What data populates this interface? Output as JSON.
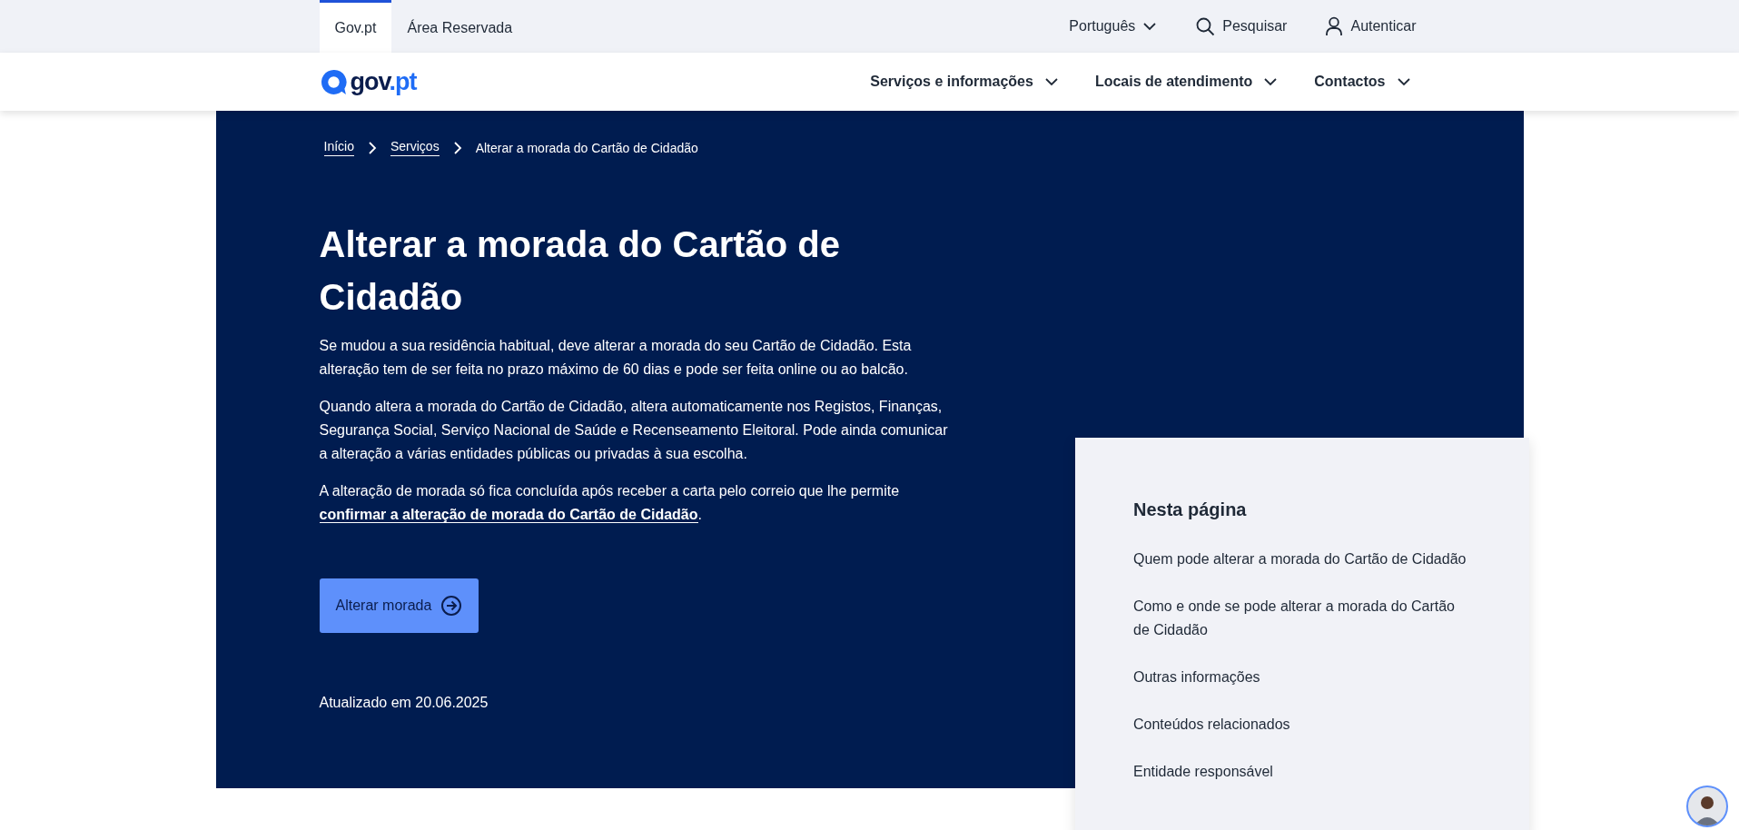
{
  "utility_bar": {
    "tabs": [
      {
        "label": "Gov.pt",
        "selected": true
      },
      {
        "label": "Área Reservada",
        "selected": false
      }
    ],
    "language": "Português",
    "search": "Pesquisar",
    "login": "Autenticar"
  },
  "header": {
    "logo": [
      "gov",
      ".pt"
    ],
    "nav": [
      "Serviços e informações",
      "Locais de atendimento",
      "Contactos"
    ]
  },
  "breadcrumb": [
    {
      "label": "Início",
      "kind": "link"
    },
    {
      "label": "Serviços",
      "kind": "link"
    },
    {
      "label": "Alterar a morada do Cartão de Cidadão",
      "kind": "current"
    }
  ],
  "hero": {
    "title": "Alterar a morada do Cartão de Cidadão",
    "paragraphs": [
      {
        "text": "Se mudou a sua residência habitual, deve alterar a morada do seu Cartão de Cidadão. Esta alteração tem de ser feita no prazo máximo de 60 dias e pode ser feita online ou ao balcão."
      },
      {
        "text": "Quando altera a morada do Cartão de Cidadão, altera automaticamente nos Registos, Finanças, Segurança Social, Serviço Nacional de Saúde e Recenseamento Eleitoral. Pode ainda comunicar a alteração a várias entidades públicas ou privadas à sua escolha."
      },
      {
        "text": "A alteração de morada só fica concluída após receber a carta pelo correio que lhe permite ",
        "link": "confirmar a alteração de morada do Cartão de Cidadão",
        "after": "."
      }
    ],
    "button": "Alterar morada",
    "updated": "Atualizado em 20.06.2025"
  },
  "toc": {
    "heading": "Nesta página",
    "items": [
      "Quem pode alterar a morada do Cartão de Cidadão",
      "Como e onde se pode alterar a morada do Cartão de Cidadão",
      "Outras informações",
      "Conteúdos relacionados",
      "Entidade responsável"
    ]
  }
}
